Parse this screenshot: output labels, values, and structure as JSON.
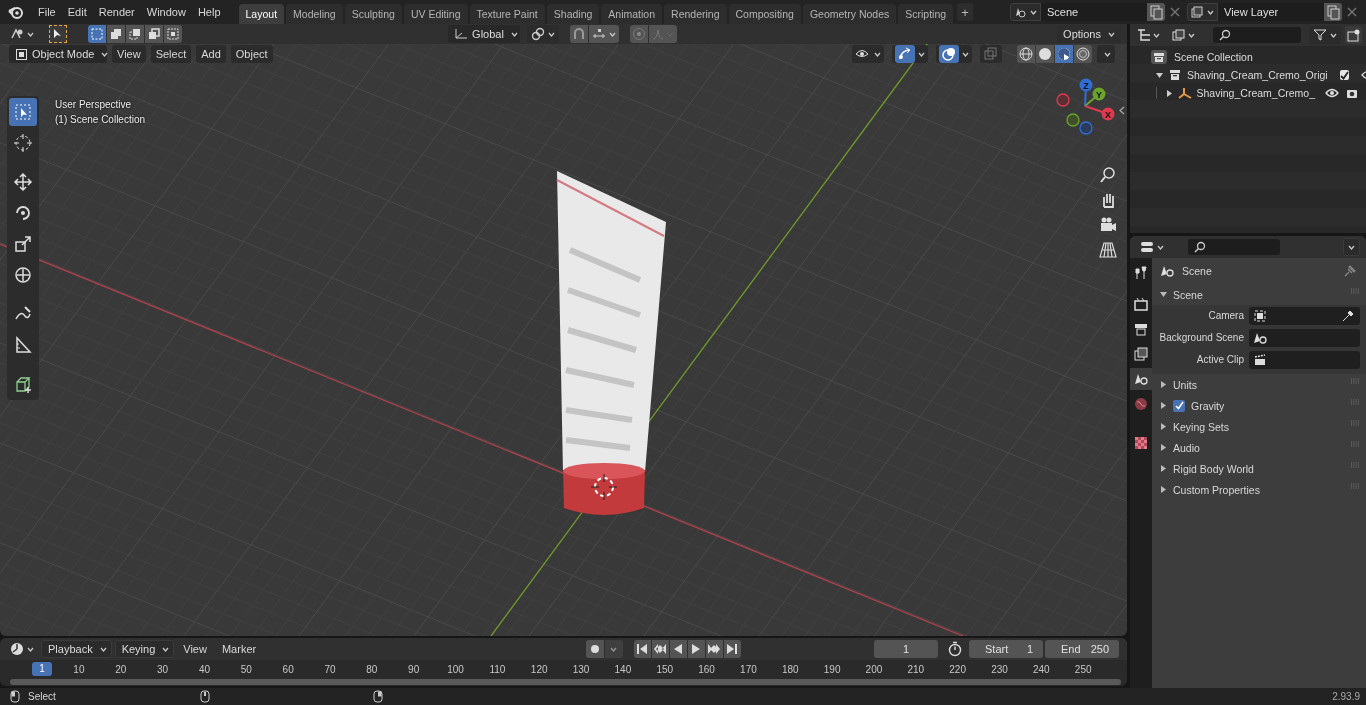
{
  "menu": [
    "File",
    "Edit",
    "Render",
    "Window",
    "Help"
  ],
  "workspaces": [
    {
      "label": "Layout",
      "selected": true
    },
    {
      "label": "Modeling",
      "selected": false
    },
    {
      "label": "Sculpting",
      "selected": false
    },
    {
      "label": "UV Editing",
      "selected": false
    },
    {
      "label": "Texture Paint",
      "selected": false
    },
    {
      "label": "Shading",
      "selected": false
    },
    {
      "label": "Animation",
      "selected": false
    },
    {
      "label": "Rendering",
      "selected": false
    },
    {
      "label": "Compositing",
      "selected": false
    },
    {
      "label": "Geometry Nodes",
      "selected": false
    },
    {
      "label": "Scripting",
      "selected": false
    }
  ],
  "add_workspace": "+",
  "scene": "Scene",
  "view_layer": "View Layer",
  "tool_header": {
    "select_modes": [
      {
        "kind": "set",
        "selected": true
      },
      {
        "kind": "extend",
        "selected": false
      },
      {
        "kind": "subtract",
        "selected": false
      },
      {
        "kind": "difference",
        "selected": false
      },
      {
        "kind": "intersect",
        "selected": false
      }
    ],
    "orientation": "Global",
    "options": "Options"
  },
  "viewport_header": {
    "mode": "Object Mode",
    "menus": [
      "View",
      "Select",
      "Add",
      "Object"
    ],
    "toggles": [
      {
        "kind": "visibility",
        "on": false
      },
      {
        "kind": "gizmos",
        "on": true
      },
      {
        "kind": "overlays",
        "on": true
      },
      {
        "kind": "xray",
        "on": false
      }
    ],
    "shading_modes": [
      {
        "kind": "wireframe",
        "selected": false
      },
      {
        "kind": "solid",
        "selected": false
      },
      {
        "kind": "material",
        "selected": true
      },
      {
        "kind": "rendered",
        "selected": false
      }
    ]
  },
  "viewport": {
    "overlay_lines": [
      "User Perspective",
      "(1) Scene Collection"
    ],
    "gizmo_axes": [
      "Z",
      "Y",
      "X"
    ]
  },
  "toolbar": [
    {
      "kind": "select",
      "selected": true
    },
    {
      "kind": "cursor",
      "selected": false
    },
    {
      "kind": "move",
      "selected": false
    },
    {
      "kind": "rotate",
      "selected": false
    },
    {
      "kind": "scale",
      "selected": false
    },
    {
      "kind": "transform",
      "selected": false
    },
    {
      "kind": "annotate",
      "selected": false
    },
    {
      "kind": "measure",
      "selected": false
    },
    {
      "kind": "add-cube",
      "selected": false
    }
  ],
  "outliner": {
    "root": "Scene Collection",
    "items": [
      {
        "label": "Shaving_Cream_Cremo_Origi",
        "kind": "collection",
        "expanded": true,
        "checked": true,
        "children": [
          {
            "label": "Shaving_Cream_Cremo_",
            "kind": "object",
            "expanded": false
          }
        ]
      }
    ]
  },
  "properties": {
    "tabs": [
      {
        "kind": "tool",
        "selected": false
      },
      {
        "kind": "render",
        "selected": false
      },
      {
        "kind": "output",
        "selected": false
      },
      {
        "kind": "view-layer",
        "selected": false
      },
      {
        "kind": "scene",
        "selected": true
      },
      {
        "kind": "world",
        "selected": false
      },
      {
        "kind": "texture",
        "selected": false
      }
    ],
    "context": "Scene",
    "panel": {
      "title": "Scene",
      "expanded": true,
      "fields": [
        {
          "label": "Camera",
          "kind": "camera"
        },
        {
          "label": "Background Scene",
          "kind": "scene"
        },
        {
          "label": "Active Clip",
          "kind": "clip"
        }
      ]
    },
    "subpanels": [
      {
        "label": "Units",
        "kind": "plain"
      },
      {
        "label": "Gravity",
        "kind": "toggle",
        "checked": true
      },
      {
        "label": "Keying Sets",
        "kind": "plain"
      },
      {
        "label": "Audio",
        "kind": "plain"
      },
      {
        "label": "Rigid Body World",
        "kind": "plain"
      },
      {
        "label": "Custom Properties",
        "kind": "plain"
      }
    ]
  },
  "timeline": {
    "menus": [
      "Playback",
      "Keying",
      "View",
      "Marker"
    ],
    "current_frame": "1",
    "start_label": "Start",
    "start": "1",
    "end_label": "End",
    "end": "250",
    "playhead": "1",
    "ticks": [
      "10",
      "20",
      "30",
      "40",
      "50",
      "60",
      "70",
      "80",
      "90",
      "100",
      "110",
      "120",
      "130",
      "140",
      "150",
      "160",
      "170",
      "180",
      "190",
      "200",
      "210",
      "220",
      "230",
      "240",
      "250"
    ]
  },
  "status_bar": {
    "hint": "Select",
    "version": "2.93.9"
  }
}
